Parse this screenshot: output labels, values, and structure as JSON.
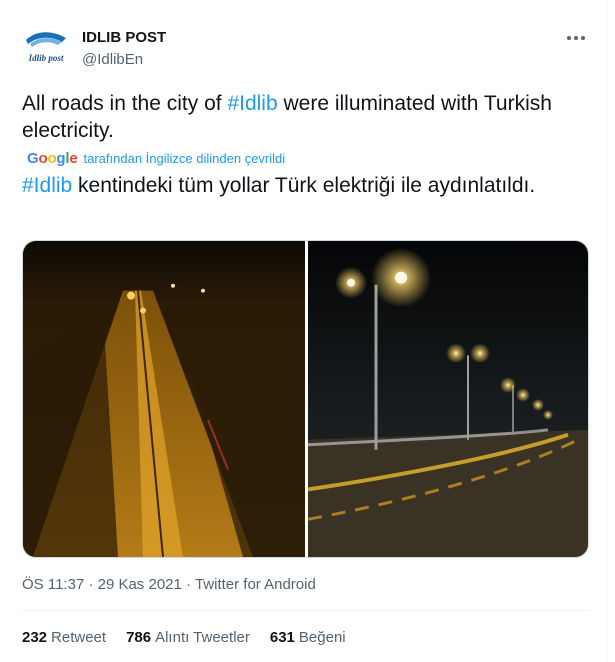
{
  "author": {
    "display_name": "IDLIB POST",
    "handle": "@IdlibEn",
    "avatar_text": "Idlib post"
  },
  "tweet": {
    "text_before_tag": "All roads in the city of ",
    "hashtag": "#Idlib",
    "text_after_tag": " were illuminated with Turkish electricity.",
    "translated_by": "tarafından İngilizce dilinden çevrildi",
    "google_logo_letters": [
      "G",
      "o",
      "o",
      "g",
      "l",
      "e"
    ],
    "translated_hashtag": "#Idlib",
    "translated_text": " kentindeki tüm yollar Türk elektriği ile aydınlatıldı."
  },
  "media": [
    {
      "name": "aerial-road-photo",
      "description_icon": "photo-icon"
    },
    {
      "name": "street-lights-photo",
      "description_icon": "photo-icon"
    }
  ],
  "meta": {
    "time": "ÖS 11:37",
    "sep1": "·",
    "date": "29 Kas 2021",
    "sep2": "·",
    "source": "Twitter for Android"
  },
  "stats": {
    "retweets_count": "232",
    "retweets_label": "Retweet",
    "quotes_count": "786",
    "quotes_label": "Alıntı Tweetler",
    "likes_count": "631",
    "likes_label": "Beğeni"
  },
  "colors": {
    "link": "#1d9bf0",
    "secondary": "#536471",
    "primary": "#0f1419"
  }
}
